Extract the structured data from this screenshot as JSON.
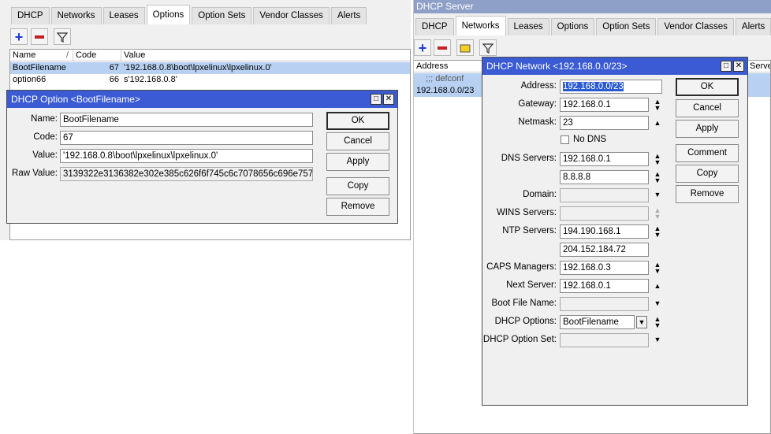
{
  "left": {
    "tabs": [
      "DHCP",
      "Networks",
      "Leases",
      "Options",
      "Option Sets",
      "Vendor Classes",
      "Alerts"
    ],
    "active_tab": "Options",
    "columns": [
      "Name",
      "Code",
      "Value"
    ],
    "sort_indicator": "/",
    "rows": [
      {
        "name": "BootFilename",
        "code": "67",
        "value": "'192.168.0.8\\boot\\lpxelinux\\lpxelinux.0'"
      },
      {
        "name": "option66",
        "code": "66",
        "value": "s'192.168.0.8'"
      }
    ]
  },
  "option_dialog": {
    "title": "DHCP Option <BootFilename>",
    "fields": {
      "name_label": "Name:",
      "name": "BootFilename",
      "code_label": "Code:",
      "code": "67",
      "value_label": "Value:",
      "value": "'192.168.0.8\\boot\\lpxelinux\\lpxelinux.0'",
      "raw_label": "Raw Value:",
      "raw": "3139322e3136382e302e385c626f6f745c6c7078656c696e7578..."
    },
    "buttons": [
      "OK",
      "Cancel",
      "Apply",
      "Copy",
      "Remove"
    ]
  },
  "right": {
    "window_title": "DHCP Server",
    "tabs": [
      "DHCP",
      "Networks",
      "Leases",
      "Options",
      "Option Sets",
      "Vendor Classes",
      "Alerts"
    ],
    "active_tab": "Networks",
    "columns": [
      "Address",
      "Serve"
    ],
    "rows": [
      {
        "address": ";;; defconf",
        "comment": true
      },
      {
        "address": "192.168.0.0/23"
      }
    ]
  },
  "network_dialog": {
    "title": "DHCP Network <192.168.0.0/23>",
    "labels": {
      "address": "Address:",
      "gateway": "Gateway:",
      "netmask": "Netmask:",
      "no_dns": "No DNS",
      "dns": "DNS Servers:",
      "domain": "Domain:",
      "wins": "WINS Servers:",
      "ntp": "NTP Servers:",
      "caps": "CAPS Managers:",
      "next_server": "Next Server:",
      "boot_file": "Boot File Name:",
      "dhcp_options": "DHCP Options:",
      "dhcp_option_set": "DHCP Option Set:"
    },
    "values": {
      "address": "192.168.0.0/23",
      "gateway": "192.168.0.1",
      "netmask": "23",
      "dns1": "192.168.0.1",
      "dns2": "8.8.8.8",
      "domain": "",
      "wins": "",
      "ntp1": "194.190.168.1",
      "ntp2": "204.152.184.72",
      "caps": "192.168.0.3",
      "next_server": "192.168.0.1",
      "boot_file": "",
      "dhcp_options": "BootFilename",
      "dhcp_option_set": ""
    },
    "buttons": [
      "OK",
      "Cancel",
      "Apply",
      "Comment",
      "Copy",
      "Remove"
    ]
  },
  "colors": {
    "title_bar": "#3b5bd4",
    "selection": "#b8d1f2",
    "accent_plus": "#1c3bd6",
    "accent_minus": "#c32020"
  }
}
